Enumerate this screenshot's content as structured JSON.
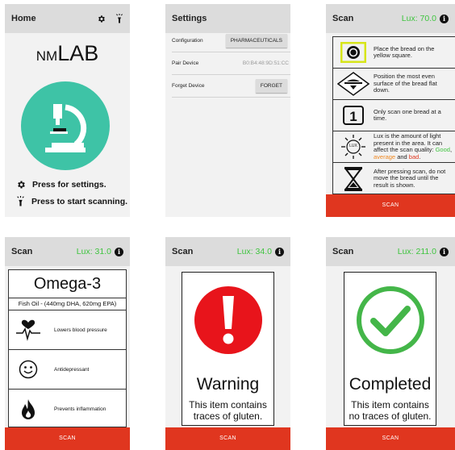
{
  "home": {
    "title": "Home",
    "logo_small": "NM",
    "logo_big": "LAB",
    "settings_hint": "Press for settings.",
    "scan_hint": "Press to start scanning."
  },
  "settings": {
    "title": "Settings",
    "rows": [
      {
        "label": "Configuration",
        "value": "PHARMACEUTICALS",
        "kind": "button"
      },
      {
        "label": "Pair Device",
        "value": "B0:B4:48:9D:51:CC",
        "kind": "text"
      },
      {
        "label": "Forget Device",
        "value": "FORGET",
        "kind": "button"
      }
    ]
  },
  "instructions": {
    "title": "Scan",
    "lux": "Lux: 70.0",
    "items": [
      "Place the bread on the yellow square.",
      "Position the most even surface of the bread flat down.",
      "Only scan one bread at a time.",
      "Lux is the amount of light present in the area. It can affect the scan quality:",
      "After pressing scan, do not move the bread until the result is shown."
    ],
    "quality_good": "Good",
    "quality_sep1": ", ",
    "quality_avg": "average",
    "quality_sep2": " and ",
    "quality_bad": "bad",
    "quality_end": ".",
    "count_icon": "1",
    "lux_icon": "LUX",
    "scan": "SCAN"
  },
  "nutrient": {
    "title": "Scan",
    "lux": "Lux: 31.0",
    "name": "Omega-3",
    "subtitle": "Fish Oil - (440mg DHA, 620mg EPA)",
    "benefits": [
      {
        "icon": "heartbeat-icon",
        "text": "Lowers blood pressure"
      },
      {
        "icon": "smiley-icon",
        "text": "Antidepressant"
      },
      {
        "icon": "flame-icon",
        "text": "Prevents inflammation"
      }
    ],
    "scan": "SCAN"
  },
  "warning": {
    "title": "Scan",
    "lux": "Lux: 34.0",
    "heading": "Warning",
    "message": "This item contains traces of gluten.",
    "scan": "SCAN"
  },
  "completed": {
    "title": "Scan",
    "lux": "Lux: 211.0",
    "heading": "Completed",
    "message": "This item contains no traces of gluten.",
    "scan": "SCAN"
  },
  "info_glyph": "i",
  "colors": {
    "accent": "#e0361f",
    "lux": "#3fc43f",
    "teal": "#3ec3a6",
    "warn_red": "#e8141b",
    "ok_green": "#44b649",
    "highlight": "#d7e51a"
  }
}
